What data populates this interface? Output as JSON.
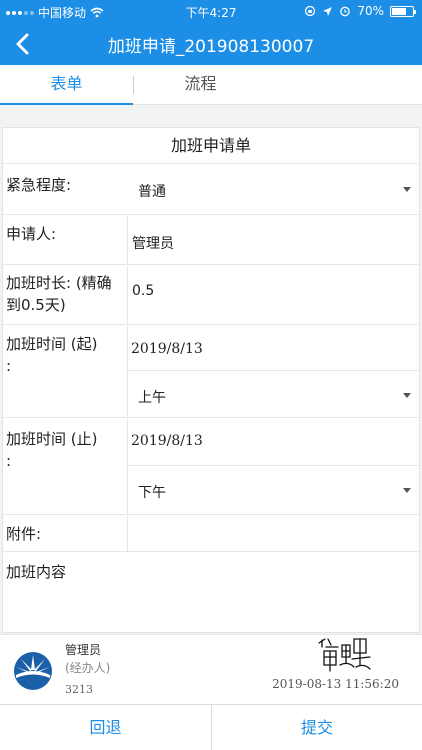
{
  "status_bar": {
    "carrier": "中国移动",
    "time": "下午4:27",
    "battery": "70%",
    "battery_level": 0.7
  },
  "nav": {
    "title": "加班申请_201908130007"
  },
  "tabs": [
    {
      "label": "表单",
      "active": true
    },
    {
      "label": "流程",
      "active": false
    }
  ],
  "form": {
    "title": "加班申请单",
    "urgency": {
      "label": "紧急程度:",
      "value": "普通"
    },
    "applicant": {
      "label": "申请人:",
      "value": "管理员"
    },
    "duration": {
      "label": "加班时长: (精确到0.5天)",
      "value": "0.5"
    },
    "start_time": {
      "label": "加班时间 (起) :",
      "date": "2019/8/13",
      "period": "上午"
    },
    "end_time": {
      "label": "加班时间 (止) :",
      "date": "2019/8/13",
      "period": "下午"
    },
    "attachment": {
      "label": "附件:"
    },
    "content": {
      "label": "加班内容"
    }
  },
  "handler": {
    "name": "管理员",
    "role": "(经办人)",
    "id": "3213",
    "timestamp": "2019-08-13 11:56:20"
  },
  "actions": {
    "back_label": "回退",
    "submit_label": "提交"
  },
  "colors": {
    "primary": "#1c8ee6"
  }
}
